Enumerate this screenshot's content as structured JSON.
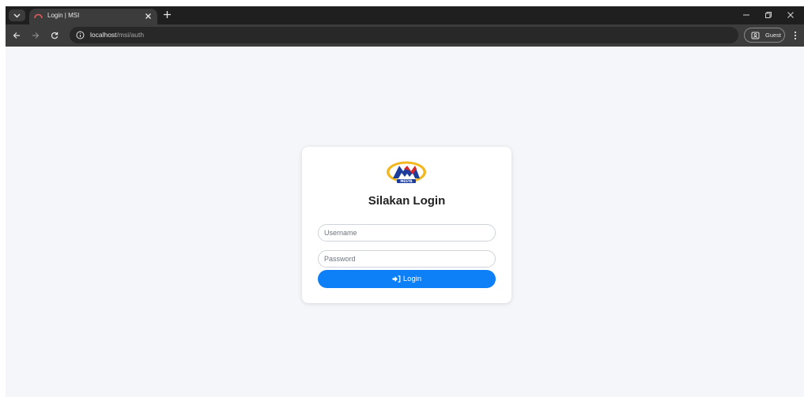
{
  "browser": {
    "tab": {
      "title": "Login | MSI"
    },
    "address_bar": {
      "host": "localhost",
      "path": "/msi/auth"
    },
    "profile": {
      "label": "Guest"
    },
    "icons": {
      "tab_menu": "chevron-down-icon",
      "favicon": "speedometer-icon",
      "tab_close": "close-icon",
      "new_tab": "plus-icon",
      "back": "arrow-left-icon",
      "forward": "arrow-right-icon",
      "reload": "reload-icon",
      "site_info": "info-icon",
      "profile": "guest-icon",
      "menu": "kebab-icon"
    }
  },
  "login": {
    "logo_text": "MESYA",
    "heading": "Silakan Login",
    "username": {
      "placeholder": "Username",
      "value": ""
    },
    "password": {
      "placeholder": "Password",
      "value": ""
    },
    "submit_label": "Login",
    "submit_icon": "sign-in-icon"
  },
  "colors": {
    "page_background": "#f4f6fa",
    "primary_button": "#0d7ff7",
    "logo_blue": "#1c3d9c",
    "logo_red": "#d8262a",
    "logo_gold": "#f3b81e"
  }
}
